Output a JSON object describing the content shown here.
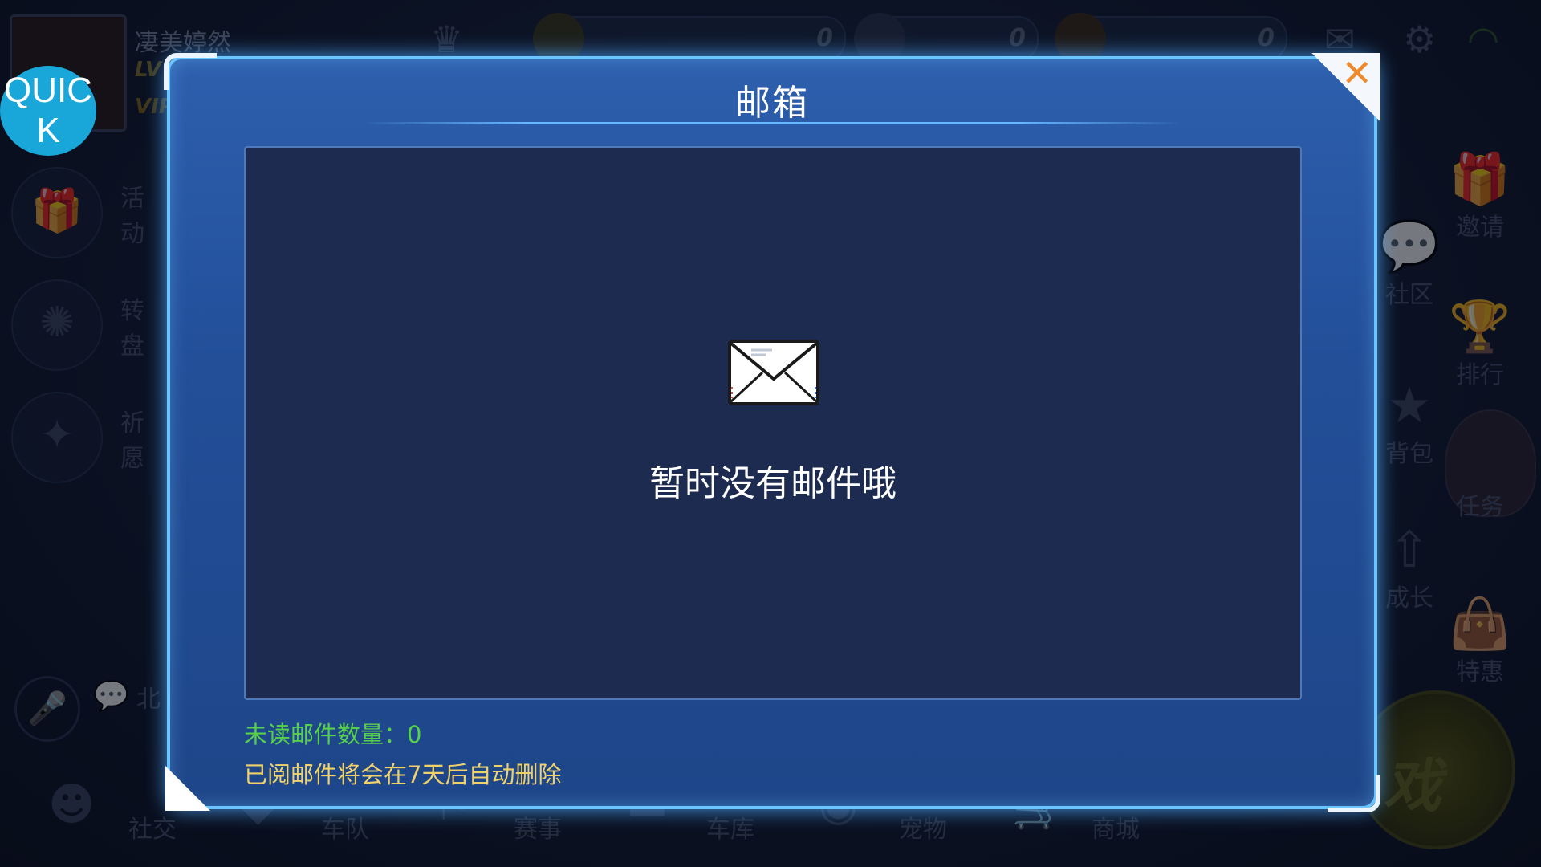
{
  "player": {
    "name": "凄美婷然",
    "level_prefix": "LV",
    "vip_prefix": "VIP"
  },
  "resources": [
    {
      "value": "0",
      "icon": "medal-icon"
    },
    {
      "value": "0",
      "icon": "diamond-icon"
    },
    {
      "value": "0",
      "icon": "coin-add-icon"
    }
  ],
  "quick_button": {
    "label_line1": "QUIC",
    "label_line2": "K"
  },
  "left_menu": [
    {
      "label": "活动",
      "icon": "gift-icon"
    },
    {
      "label": "转盘",
      "icon": "wheel-icon"
    },
    {
      "label": "祈愿",
      "icon": "magic-wand-icon"
    }
  ],
  "right_menu": [
    {
      "label": "邀请",
      "icon": "gift-box-icon"
    },
    {
      "label": "社区",
      "icon": "chat-icon"
    },
    {
      "label": "排行",
      "icon": "trophy-icon"
    },
    {
      "label": "背包",
      "icon": "backpack-icon"
    },
    {
      "label": "任务",
      "icon": "quest-avatar-icon"
    },
    {
      "label": "成长",
      "icon": "growth-icon"
    },
    {
      "label": "特惠",
      "icon": "shopping-bag-icon"
    }
  ],
  "bottom_menu": [
    {
      "label": "社交",
      "icon": "social-icon"
    },
    {
      "label": "车队",
      "icon": "team-icon"
    },
    {
      "label": "赛事",
      "icon": "flag-icon"
    },
    {
      "label": "车库",
      "icon": "car-icon"
    },
    {
      "label": "宠物",
      "icon": "pet-icon"
    },
    {
      "label": "商城",
      "icon": "cart-icon"
    }
  ],
  "chat": {
    "preview": "北"
  },
  "start_button": {
    "label": "戏"
  },
  "mailbox": {
    "title": "邮箱",
    "empty_message": "暂时没有邮件哦",
    "unread_label": "未读邮件数量：",
    "unread_count": "0",
    "auto_delete_note": "已阅邮件将会在7天后自动删除"
  },
  "colors": {
    "modal_bg": "#2455a0",
    "modal_border": "#69c4ff",
    "panel_bg": "#1c2b4f",
    "unread_text": "#58d14a",
    "note_text": "#f0d26a",
    "close_x": "#ee8a2c",
    "quick_bg": "#18a7d8"
  }
}
